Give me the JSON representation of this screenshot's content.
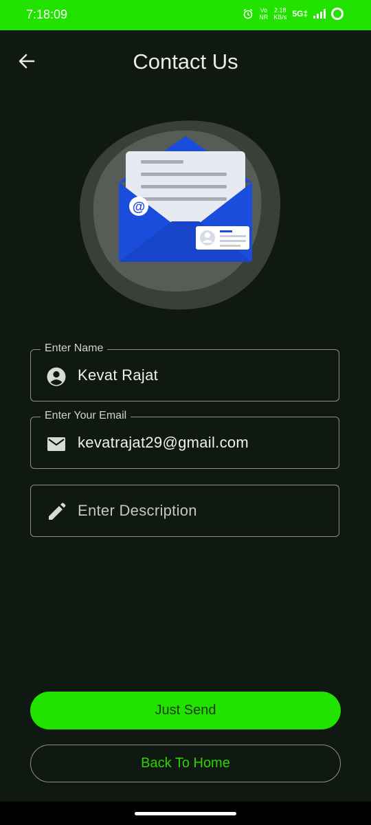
{
  "status_bar": {
    "time": "7:18:09",
    "net_speed_value": "2.18",
    "net_speed_unit": "KB/s",
    "network": "5G‡",
    "vo_label": "Vo",
    "nr_label": "NR"
  },
  "app_bar": {
    "title": "Contact Us",
    "back_icon": "arrow-left-icon"
  },
  "form": {
    "name_field": {
      "label": "Enter Name",
      "value": "Kevat Rajat",
      "icon": "account-circle-icon"
    },
    "email_field": {
      "label": "Enter Your Email",
      "value": "kevatrajat29@gmail.com",
      "icon": "mail-icon"
    },
    "description_field": {
      "placeholder": "Enter Description",
      "value": "",
      "icon": "pencil-icon"
    }
  },
  "actions": {
    "send_label": "Just Send",
    "home_label": "Back To Home"
  },
  "colors": {
    "accent": "#22e200",
    "background": "#101812",
    "envelope": "#1b4ddc"
  }
}
